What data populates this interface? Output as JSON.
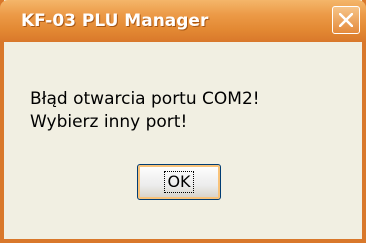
{
  "window": {
    "title": "KF-03 PLU Manager",
    "close_icon": "close-icon"
  },
  "message": {
    "line1": "Błąd otwarcia portu COM2!",
    "line2": "Wybierz inny port!"
  },
  "buttons": {
    "ok_label": "OK"
  },
  "colors": {
    "titlebar": "#e38933",
    "frame": "#d9782b",
    "client_background": "#f1efe2",
    "title_text": "#ffffff"
  }
}
